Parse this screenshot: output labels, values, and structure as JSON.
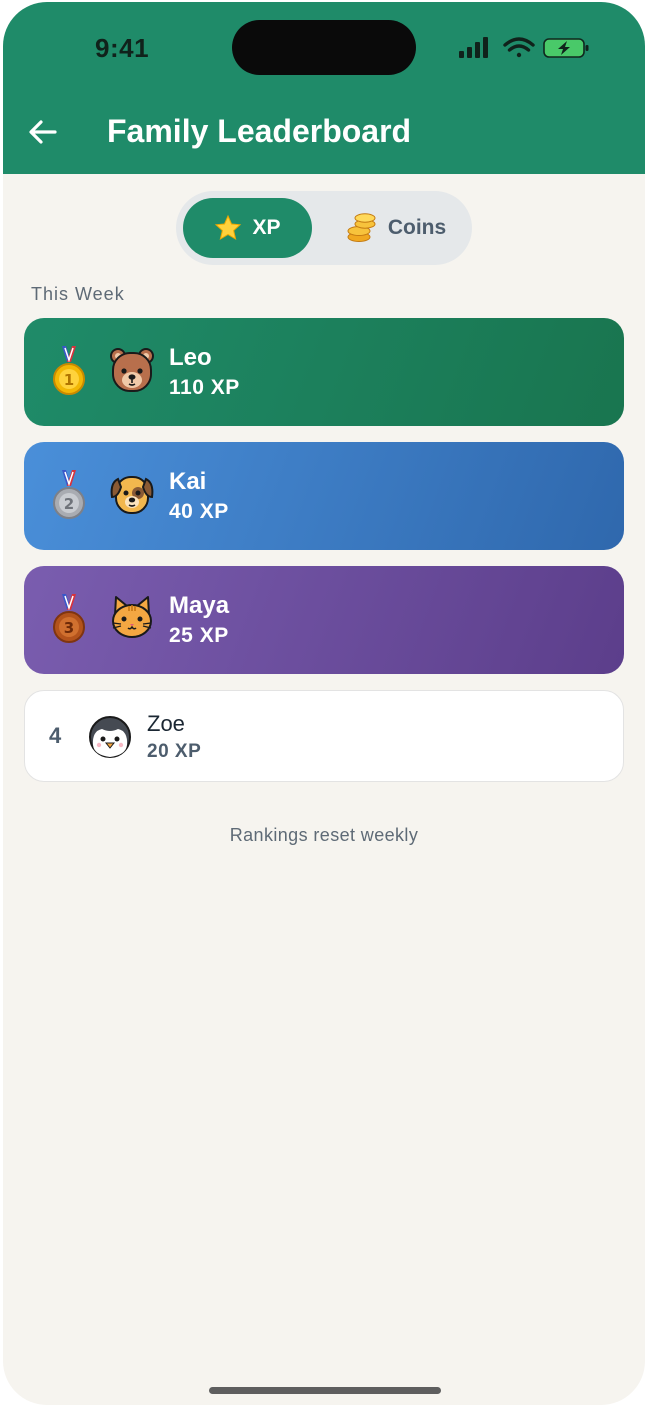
{
  "status_bar": {
    "time": "9:41"
  },
  "header": {
    "title": "Family Leaderboard"
  },
  "toggle": {
    "xp_label": "XP",
    "coins_label": "Coins",
    "selected": "XP"
  },
  "section_title": "This Week",
  "leaders": [
    {
      "rank": "1",
      "name": "Leo",
      "score": "110 XP",
      "avatar": "bear-icon",
      "medal": "gold"
    },
    {
      "rank": "2",
      "name": "Kai",
      "score": "40 XP",
      "avatar": "dog-icon",
      "medal": "silver"
    },
    {
      "rank": "3",
      "name": "Maya",
      "score": "25 XP",
      "avatar": "cat-icon",
      "medal": "bronze"
    },
    {
      "rank": "4",
      "name": "Zoe",
      "score": "20 XP",
      "avatar": "penguin-icon"
    }
  ],
  "footer_note": "Rankings reset weekly",
  "colors": {
    "primary": "#1f8b69",
    "second_card": "#4a8fd9",
    "third_card": "#7a5daf",
    "background": "#f6f4ef"
  }
}
